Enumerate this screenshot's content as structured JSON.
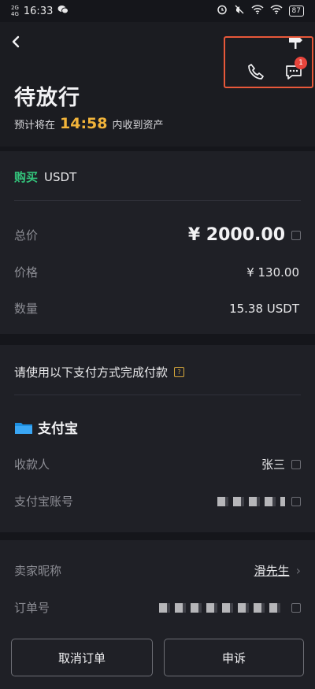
{
  "status_bar": {
    "signal1": "2G",
    "signal2": "4G",
    "time": "16:33",
    "battery": "87"
  },
  "header": {
    "title": "待放行",
    "subtitle_prefix": "预计将在",
    "countdown": "14:58",
    "subtitle_suffix": "内收到资产",
    "chat_badge": "1",
    "icons": {
      "back": "back-arrow-icon",
      "sign": "signpost-icon",
      "phone": "phone-icon",
      "chat": "chat-icon"
    }
  },
  "order": {
    "side": "购买",
    "asset": "USDT",
    "total_label": "总价",
    "total_value": "¥ 2000.00",
    "price_label": "价格",
    "price_value": "¥ 130.00",
    "quantity_label": "数量",
    "quantity_value": "15.38 USDT"
  },
  "payment": {
    "instruction": "请使用以下支付方式完成付款",
    "method": "支付宝",
    "payee_label": "收款人",
    "payee_value": "张三",
    "account_label": "支付宝账号"
  },
  "details": {
    "seller_label": "卖家昵称",
    "seller_value": "滑先生",
    "order_no_label": "订单号"
  },
  "buttons": {
    "cancel": "取消订单",
    "appeal": "申诉"
  },
  "colors": {
    "buy_green": "#33c37b",
    "countdown_orange": "#f2b43a",
    "highlight_red": "#e8583a",
    "badge_red": "#e8453c"
  }
}
